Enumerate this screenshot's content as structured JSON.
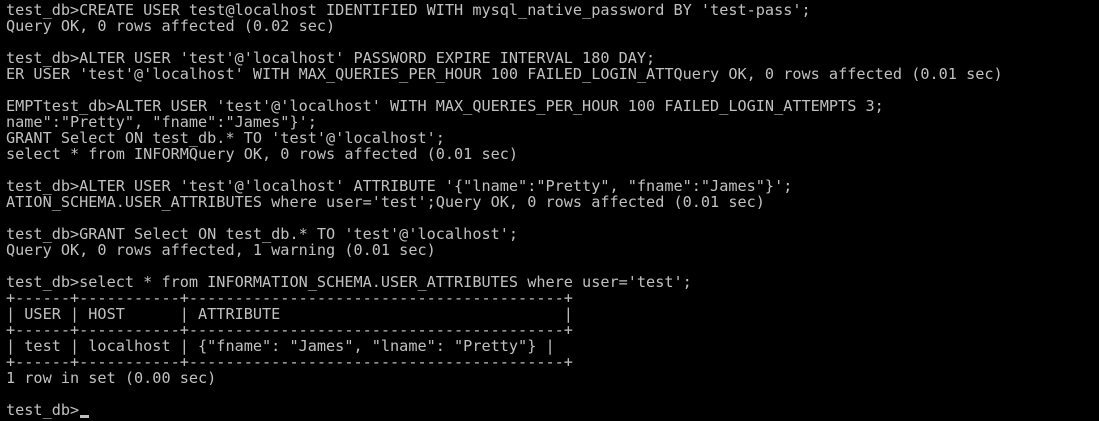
{
  "terminal": {
    "colors": {
      "background": "#000000",
      "text": "#c0c0c0"
    },
    "lines": [
      "test_db>CREATE USER test@localhost IDENTIFIED WITH mysql_native_password BY 'test-pass';",
      "Query OK, 0 rows affected (0.02 sec)",
      "",
      "test_db>ALTER USER 'test'@'localhost' PASSWORD EXPIRE INTERVAL 180 DAY;",
      "ER USER 'test'@'localhost' WITH MAX_QUERIES_PER_HOUR 100 FAILED_LOGIN_ATTQuery OK, 0 rows affected (0.01 sec)",
      "",
      "EMPTtest_db>ALTER USER 'test'@'localhost' WITH MAX_QUERIES_PER_HOUR 100 FAILED_LOGIN_ATTEMPTS 3;",
      "name\":\"Pretty\", \"fname\":\"James\"}';",
      "GRANT Select ON test_db.* TO 'test'@'localhost';",
      "select * from INFORMQuery OK, 0 rows affected (0.01 sec)",
      "",
      "test_db>ALTER USER 'test'@'localhost' ATTRIBUTE '{\"lname\":\"Pretty\", \"fname\":\"James\"}';",
      "ATION_SCHEMA.USER_ATTRIBUTES where user='test';Query OK, 0 rows affected (0.01 sec)",
      "",
      "test_db>GRANT Select ON test_db.* TO 'test'@'localhost';",
      "Query OK, 0 rows affected, 1 warning (0.01 sec)",
      "",
      "test_db>select * from INFORMATION_SCHEMA.USER_ATTRIBUTES where user='test';",
      "+------+-----------+-----------------------------------------+",
      "| USER | HOST      | ATTRIBUTE                               |",
      "+------+-----------+-----------------------------------------+",
      "| test | localhost | {\"fname\": \"James\", \"lname\": \"Pretty\"} |",
      "+------+-----------+-----------------------------------------+",
      "1 row in set (0.00 sec)",
      ""
    ],
    "prompt": "test_db>"
  }
}
